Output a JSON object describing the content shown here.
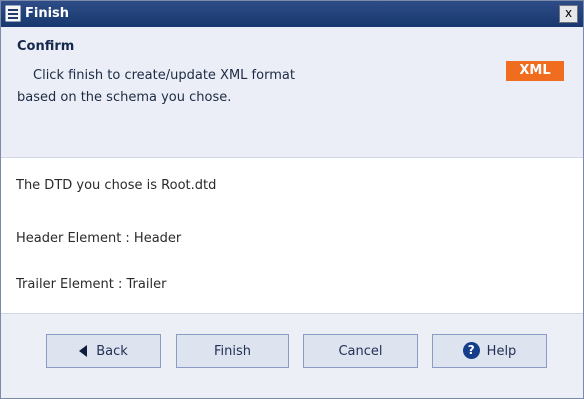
{
  "window": {
    "title": "Finish",
    "close_label": "x"
  },
  "confirm": {
    "heading": "Confirm",
    "line1": "Click finish to create/update XML format",
    "line2": "based on the schema you chose.",
    "badge": "XML"
  },
  "details": {
    "dtd_line": "The DTD you chose is Root.dtd",
    "header_line": "Header Element : Header",
    "trailer_line": "Trailer Element : Trailer"
  },
  "buttons": {
    "back": "Back",
    "finish": "Finish",
    "cancel": "Cancel",
    "help": "Help",
    "help_icon": "?"
  },
  "colors": {
    "titlebar": "#1d3f7a",
    "accent_badge": "#f06c1e"
  }
}
